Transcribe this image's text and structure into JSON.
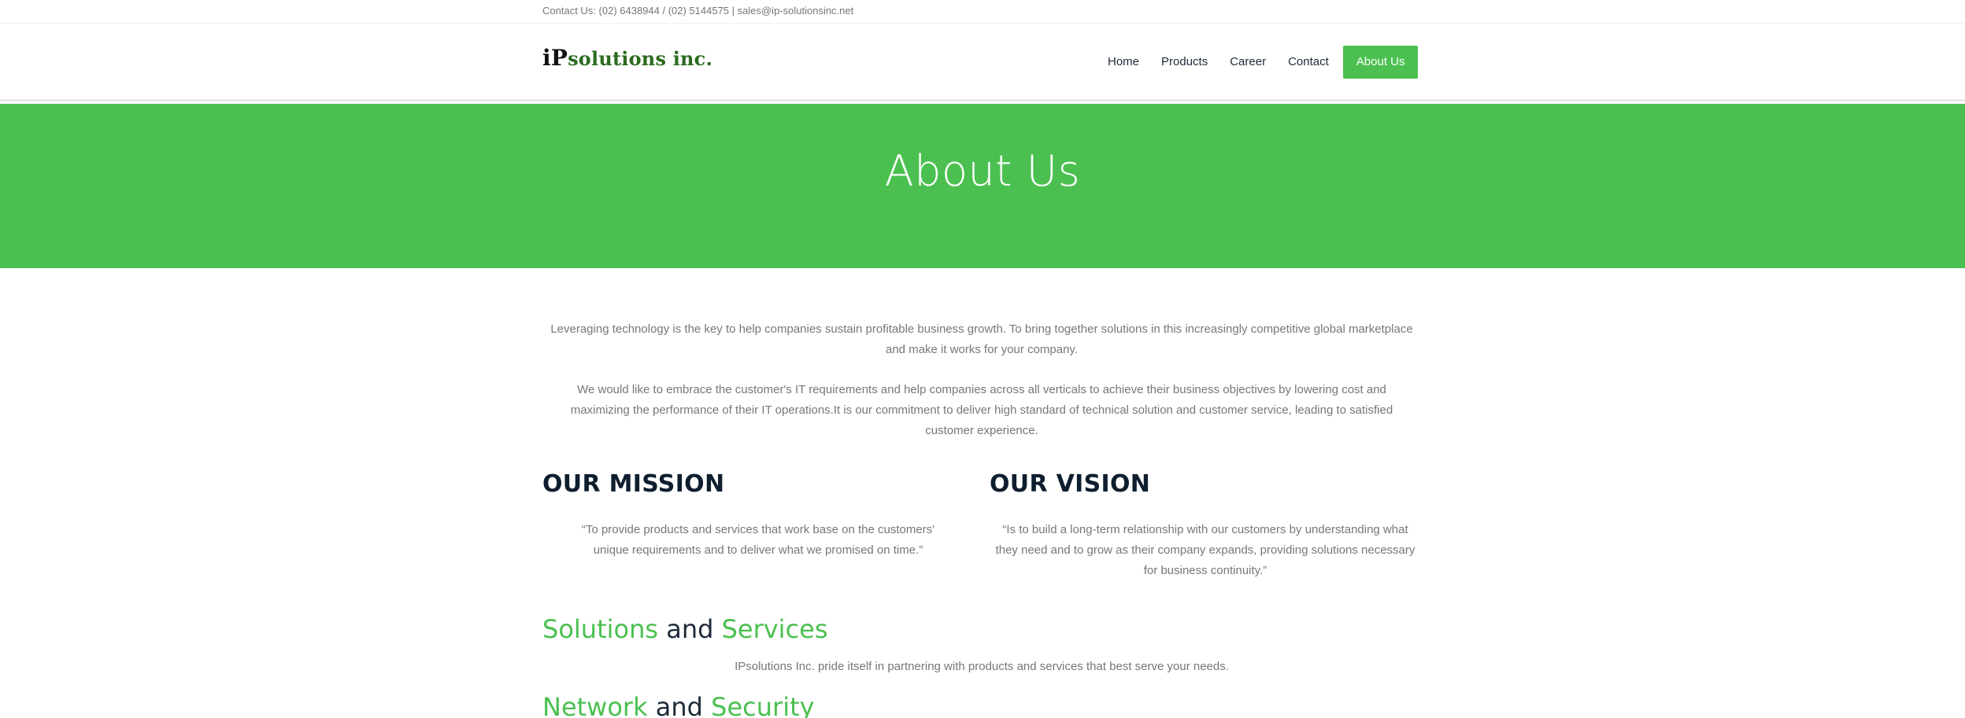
{
  "topbar": {
    "contact": "Contact Us: (02) 6438944 / (02) 5144575 | sales@ip-solutionsinc.net"
  },
  "brand": {
    "logo_ip": "iP",
    "logo_rest": "solutions inc."
  },
  "nav": {
    "items": [
      {
        "label": "Home"
      },
      {
        "label": "Products"
      },
      {
        "label": "Career"
      },
      {
        "label": "Contact"
      },
      {
        "label": "About Us",
        "active": true
      }
    ]
  },
  "hero": {
    "title": "About Us"
  },
  "intro": {
    "p1": "Leveraging technology is the key to help companies sustain profitable business growth. To bring together solutions in this increasingly competitive global marketplace and make it works for your company.",
    "p2": "We would like to embrace the customer's IT requirements and help companies across all verticals to achieve their business objectives by lowering cost and maximizing the performance of their IT operations.It is our commitment to deliver high standard of technical solution and customer service, leading to satisfied customer experience."
  },
  "mission": {
    "title": "OUR MISSION",
    "text": "“To provide products and services that work base on the customers' unique requirements and to deliver what we promised on time.”"
  },
  "vision": {
    "title": "OUR VISION",
    "text": "“Is to build a long-term relationship with our customers by understanding what they need and to grow as their company expands, providing solutions necessary for business continuity.”"
  },
  "solutions": {
    "word1": "Solutions",
    "joiner": "and",
    "word2": "Services",
    "desc": "IPsolutions Inc. pride itself in partnering with products and services that best serve your needs."
  },
  "network": {
    "word1": "Network",
    "joiner": "and",
    "word2": "Security"
  },
  "colors": {
    "accent": "#4bc050",
    "heading": "#0f1e2e",
    "body_text": "#777777"
  }
}
